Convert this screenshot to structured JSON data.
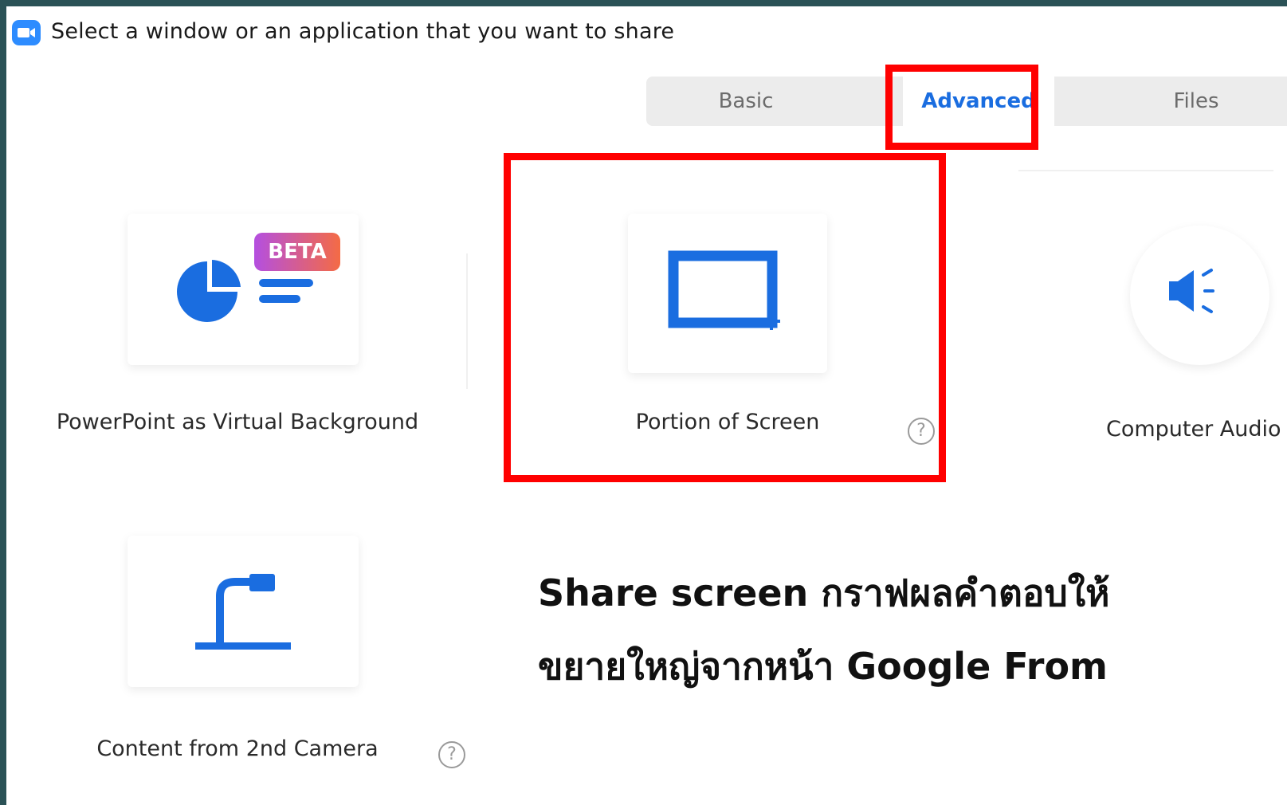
{
  "window": {
    "title": "Select a window or an application that you want to share"
  },
  "tabs": [
    {
      "label": "Basic",
      "active": false
    },
    {
      "label": "Advanced",
      "active": true
    },
    {
      "label": "Files",
      "active": false
    }
  ],
  "options": [
    {
      "label": "PowerPoint as Virtual Background",
      "badge": "BETA",
      "icon": "powerpoint-chart-icon"
    },
    {
      "label": "Portion of Screen",
      "icon": "portion-of-screen-icon",
      "help": "?"
    },
    {
      "label": "Computer Audio",
      "icon": "speaker-icon"
    },
    {
      "label": "Content from 2nd Camera",
      "icon": "document-camera-icon",
      "help": "?"
    }
  ],
  "annotation": {
    "line1": "Share screen กราฟผลคำตอบให้",
    "line2": "ขยายใหญ่จากหน้า Google From"
  },
  "colors": {
    "accent": "#1a6de0",
    "highlight": "#ff0000",
    "background": "#2b5256"
  }
}
